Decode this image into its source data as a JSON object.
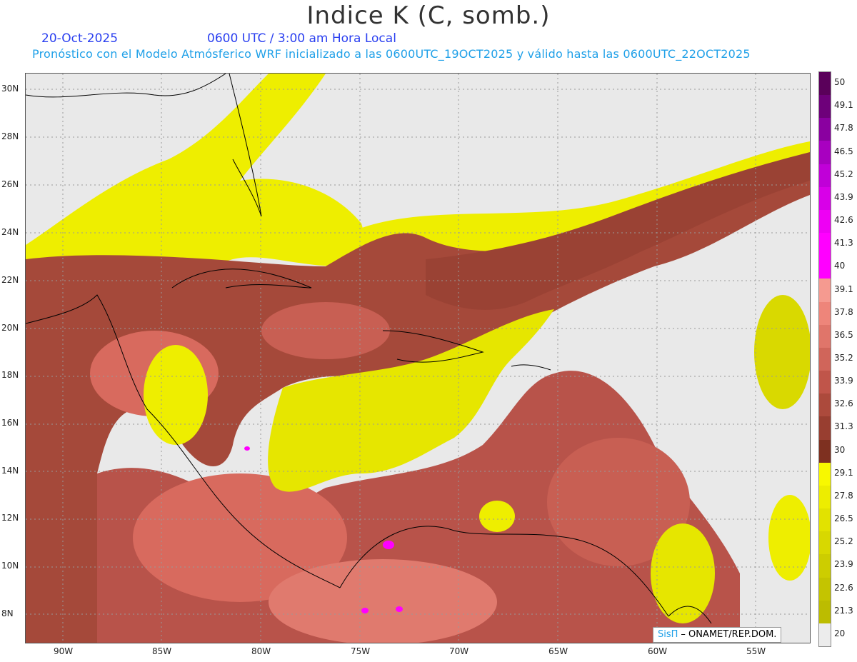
{
  "header": {
    "title": "Indice K (C, somb.)",
    "date": "20-Oct-2025",
    "time": "0600 UTC / 3:00 am Hora Local",
    "subtitle": "Pronóstico con el Modelo Atmósferico WRF inicializado a las 0600UTC_19OCT2025 y válido hasta las  0600UTC_22OCT2025"
  },
  "map": {
    "lat_labels": [
      "30N",
      "28N",
      "26N",
      "24N",
      "22N",
      "20N",
      "18N",
      "16N",
      "14N",
      "12N",
      "10N",
      "8N"
    ],
    "lon_labels": [
      "90W",
      "85W",
      "80W",
      "75W",
      "70W",
      "65W",
      "60W",
      "55W"
    ],
    "colors": {
      "background": "#e9e9e9",
      "yellow_high": "#f4f400",
      "yellow_mid": "#d9d900",
      "brown_dark": "#8c3a2a",
      "brown": "#a5493a",
      "salmon": "#d86a5e",
      "pink": "#f08a80",
      "magenta": "#ff00ff"
    }
  },
  "colorbar": {
    "labels": [
      "50",
      "49.1",
      "47.8",
      "46.5",
      "45.2",
      "43.9",
      "42.6",
      "41.3",
      "40",
      "39.1",
      "37.8",
      "36.5",
      "35.2",
      "33.9",
      "32.6",
      "31.3",
      "30",
      "29.1",
      "27.8",
      "26.5",
      "25.2",
      "23.9",
      "22.6",
      "21.3",
      "20"
    ],
    "segments": [
      "#5a005a",
      "#6e007a",
      "#8a00a0",
      "#a800c0",
      "#c000d8",
      "#d800e8",
      "#ee00f4",
      "#ff00ff",
      "#ff00ff",
      "#f59a90",
      "#ee857a",
      "#e0756a",
      "#d0655a",
      "#c0554a",
      "#ac4a3c",
      "#983e30",
      "#7e3020",
      "#f8f800",
      "#eded00",
      "#e2e200",
      "#d8d800",
      "#cdcd00",
      "#c4c400",
      "#bcbc00",
      "#ececec"
    ]
  },
  "credit": {
    "logo": "SisΠ",
    "text": "– ONAMET/REP.DOM."
  }
}
